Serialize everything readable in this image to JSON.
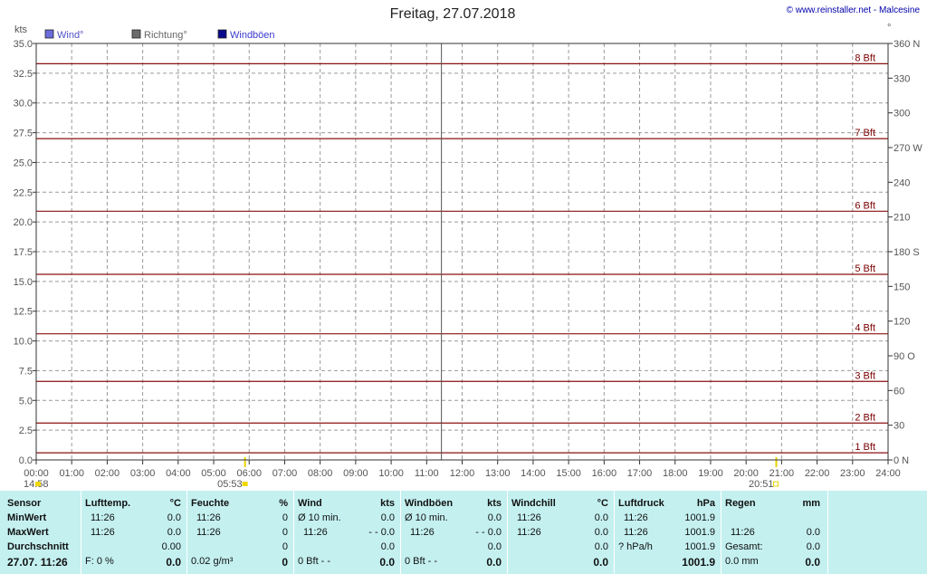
{
  "title": "Freitag, 27.07.2018",
  "credit": "© www.reinstaller.net - Malcesine",
  "legend": [
    {
      "label": "Wind°",
      "color": "#6b6bdb",
      "text_color": "#5050c8"
    },
    {
      "label": "Richtung°",
      "color": "#6b6b6b",
      "text_color": "#666666"
    },
    {
      "label": "Windböen",
      "color": "#0a0a8c",
      "text_color": "#3a3ad0"
    }
  ],
  "chart_data": {
    "type": "line",
    "title": "Freitag, 27.07.2018",
    "ylabel": "kts",
    "y2label": "°",
    "ylim": [
      0,
      35
    ],
    "y2lim": [
      0,
      360
    ],
    "xlim": [
      "00:00",
      "24:00"
    ],
    "x_ticks": [
      "00:00",
      "01:00",
      "02:00",
      "03:00",
      "04:00",
      "05:00",
      "06:00",
      "07:00",
      "08:00",
      "09:00",
      "10:00",
      "11:00",
      "12:00",
      "13:00",
      "14:00",
      "15:00",
      "16:00",
      "17:00",
      "18:00",
      "19:00",
      "20:00",
      "21:00",
      "22:00",
      "23:00",
      "24:00"
    ],
    "y_ticks": [
      "0.0",
      "2.5",
      "5.0",
      "7.5",
      "10.0",
      "12.5",
      "15.0",
      "17.5",
      "20.0",
      "22.5",
      "25.0",
      "27.5",
      "30.0",
      "32.5",
      "35.0"
    ],
    "y2_ticks": [
      {
        "v": 0,
        "label": "0 N"
      },
      {
        "v": 30,
        "label": "30"
      },
      {
        "v": 60,
        "label": "60"
      },
      {
        "v": 90,
        "label": "90 O"
      },
      {
        "v": 120,
        "label": "120"
      },
      {
        "v": 150,
        "label": "150"
      },
      {
        "v": 180,
        "label": "180 S"
      },
      {
        "v": 210,
        "label": "210"
      },
      {
        "v": 240,
        "label": "240"
      },
      {
        "v": 270,
        "label": "270 W"
      },
      {
        "v": 300,
        "label": "300"
      },
      {
        "v": 330,
        "label": "330"
      },
      {
        "v": 360,
        "label": "360 N"
      }
    ],
    "grid": true,
    "series": [
      {
        "name": "Wind°",
        "values": []
      },
      {
        "name": "Richtung°",
        "values": []
      },
      {
        "name": "Windböen",
        "values": []
      }
    ],
    "beaufort_lines": [
      {
        "label": "1 Bft",
        "value": 0.6
      },
      {
        "label": "2 Bft",
        "value": 3.1
      },
      {
        "label": "3 Bft",
        "value": 6.6
      },
      {
        "label": "4 Bft",
        "value": 10.6
      },
      {
        "label": "5 Bft",
        "value": 15.6
      },
      {
        "label": "6 Bft",
        "value": 20.9
      },
      {
        "label": "7 Bft",
        "value": 27.0
      },
      {
        "label": "8 Bft",
        "value": 33.3
      }
    ],
    "current_time_marker": "11:25",
    "sun_events": [
      {
        "label": "14:58",
        "time": "00:00",
        "type": "moonset"
      },
      {
        "label": "05:53",
        "time": "05:53",
        "type": "sunrise"
      },
      {
        "label": "20:51",
        "time": "20:51",
        "type": "sunset"
      }
    ]
  },
  "table": {
    "row_labels": {
      "sensor": "Sensor",
      "min": "MinWert",
      "max": "MaxWert",
      "avg": "Durchschnitt",
      "current": "27.07. 11:26"
    },
    "lufttemp": {
      "name": "Lufttemp.",
      "unit": "°C",
      "min_time": "11:26",
      "min_val": "0.0",
      "max_time": "11:26",
      "max_val": "0.0",
      "avg_val": "0.00",
      "cur_label": "F: 0 %",
      "cur_val": "0.0"
    },
    "feuchte": {
      "name": "Feuchte",
      "unit": "%",
      "min_time": "11:26",
      "min_val": "0",
      "max_time": "11:26",
      "max_val": "0",
      "avg_val": "0",
      "cur_label": "0.02 g/m³",
      "cur_val": "0"
    },
    "wind": {
      "name": "Wind",
      "unit": "kts",
      "min_label": "Ø 10 min.",
      "min_val": "0.0",
      "max_time": "11:26",
      "max_val": "- - 0.0",
      "avg_val": "0.0",
      "cur_label": "0 Bft - -",
      "cur_val": "0.0"
    },
    "windboeen": {
      "name": "Windböen",
      "unit": "kts",
      "min_label": "Ø 10 min.",
      "min_val": "0.0",
      "max_time": "11:26",
      "max_val": "- - 0.0",
      "avg_val": "0.0",
      "cur_label": "0 Bft - -",
      "cur_val": "0.0"
    },
    "windchill": {
      "name": "Windchill",
      "unit": "°C",
      "min_time": "11:26",
      "min_val": "0.0",
      "max_time": "11:26",
      "max_val": "0.0",
      "avg_val": "0.0",
      "cur_val": "0.0"
    },
    "luftdruck": {
      "name": "Luftdruck",
      "unit": "hPa",
      "min_time": "11:26",
      "min_val": "1001.9",
      "max_time": "11:26",
      "max_val": "1001.9",
      "avg_label": "? hPa/h",
      "avg_val": "1001.9",
      "cur_val": "1001.9"
    },
    "regen": {
      "name": "Regen",
      "unit": "mm",
      "max_time": "11:26",
      "max_val": "0.0",
      "avg_label": "Gesamt:",
      "avg_val": "0.0",
      "cur_label": "0.0 mm",
      "cur_val": "0.0"
    }
  }
}
